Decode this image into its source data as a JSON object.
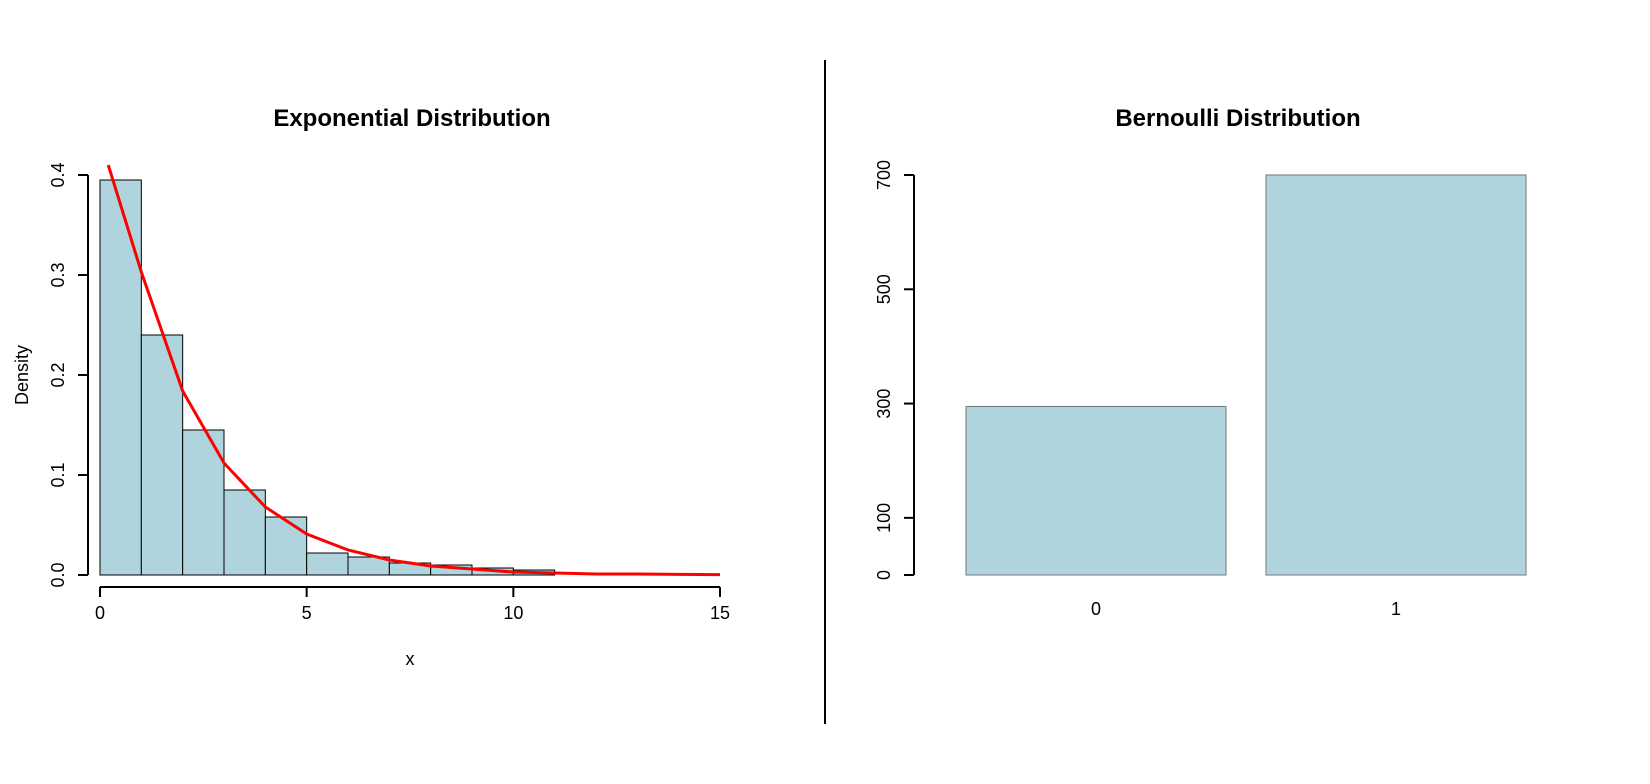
{
  "left": {
    "title": "Exponential Distribution",
    "xlabel": "x",
    "ylabel": "Density",
    "xticks": [
      0,
      5,
      10,
      15
    ],
    "yticks": [
      0.0,
      0.1,
      0.2,
      0.3,
      0.4
    ]
  },
  "right": {
    "title": "Bernoulli Distribution",
    "xlabel": "",
    "ylabel": "",
    "xticks": [
      0,
      1
    ],
    "yticks": [
      0,
      100,
      300,
      500,
      700
    ]
  },
  "chart_data": [
    {
      "type": "bar",
      "title": "Exponential Distribution",
      "xlabel": "x",
      "ylabel": "Density",
      "xlim": [
        0,
        15
      ],
      "ylim": [
        0,
        0.4
      ],
      "bin_edges": [
        0,
        1,
        2,
        3,
        4,
        5,
        6,
        7,
        8,
        9,
        10,
        11
      ],
      "bar_heights": [
        0.395,
        0.24,
        0.145,
        0.085,
        0.058,
        0.022,
        0.018,
        0.012,
        0.01,
        0.007,
        0.005
      ],
      "overlay": {
        "type": "line",
        "name": "exponential_pdf",
        "rate": 0.5,
        "x": [
          0.2,
          1,
          2,
          3,
          4,
          5,
          6,
          7,
          8,
          9,
          10,
          11,
          12,
          13,
          14,
          15
        ],
        "y": [
          0.41,
          0.303,
          0.184,
          0.112,
          0.068,
          0.041,
          0.025,
          0.015,
          0.009,
          0.006,
          0.003,
          0.002,
          0.001,
          0.001,
          0.0006,
          0.0004
        ],
        "color": "#ff0000"
      },
      "bar_color": "#b0d4de"
    },
    {
      "type": "bar",
      "title": "Bernoulli Distribution",
      "categories": [
        "0",
        "1"
      ],
      "values": [
        295,
        705
      ],
      "ylim": [
        0,
        700
      ],
      "bar_color": "#b0d4de"
    }
  ]
}
